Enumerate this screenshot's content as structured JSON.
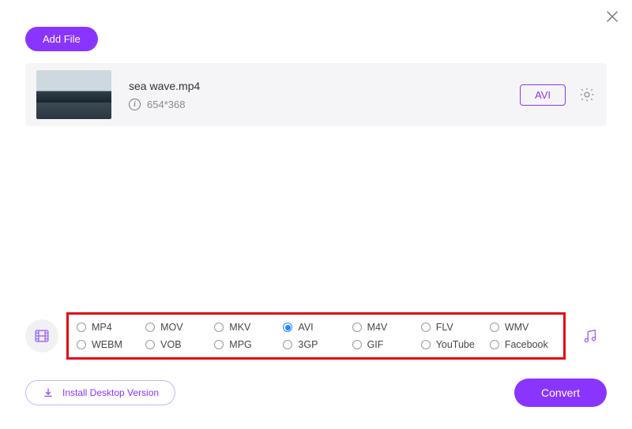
{
  "close_icon": "close",
  "add_file_label": "Add File",
  "file": {
    "name": "sea wave.mp4",
    "dimensions": "654*368",
    "target_format": "AVI"
  },
  "icons": {
    "video": "film",
    "audio": "music",
    "download": "download",
    "settings": "gear",
    "info": "i"
  },
  "formats": [
    {
      "label": "MP4",
      "selected": false
    },
    {
      "label": "MOV",
      "selected": false
    },
    {
      "label": "MKV",
      "selected": false
    },
    {
      "label": "AVI",
      "selected": true
    },
    {
      "label": "M4V",
      "selected": false
    },
    {
      "label": "FLV",
      "selected": false
    },
    {
      "label": "WMV",
      "selected": false
    },
    {
      "label": "WEBM",
      "selected": false
    },
    {
      "label": "VOB",
      "selected": false
    },
    {
      "label": "MPG",
      "selected": false
    },
    {
      "label": "3GP",
      "selected": false
    },
    {
      "label": "GIF",
      "selected": false
    },
    {
      "label": "YouTube",
      "selected": false
    },
    {
      "label": "Facebook",
      "selected": false
    }
  ],
  "install_label": "Install Desktop Version",
  "convert_label": "Convert",
  "colors": {
    "accent": "#8a35ff",
    "highlight_border": "#e30613",
    "radio_selected": "#1e88ff"
  }
}
